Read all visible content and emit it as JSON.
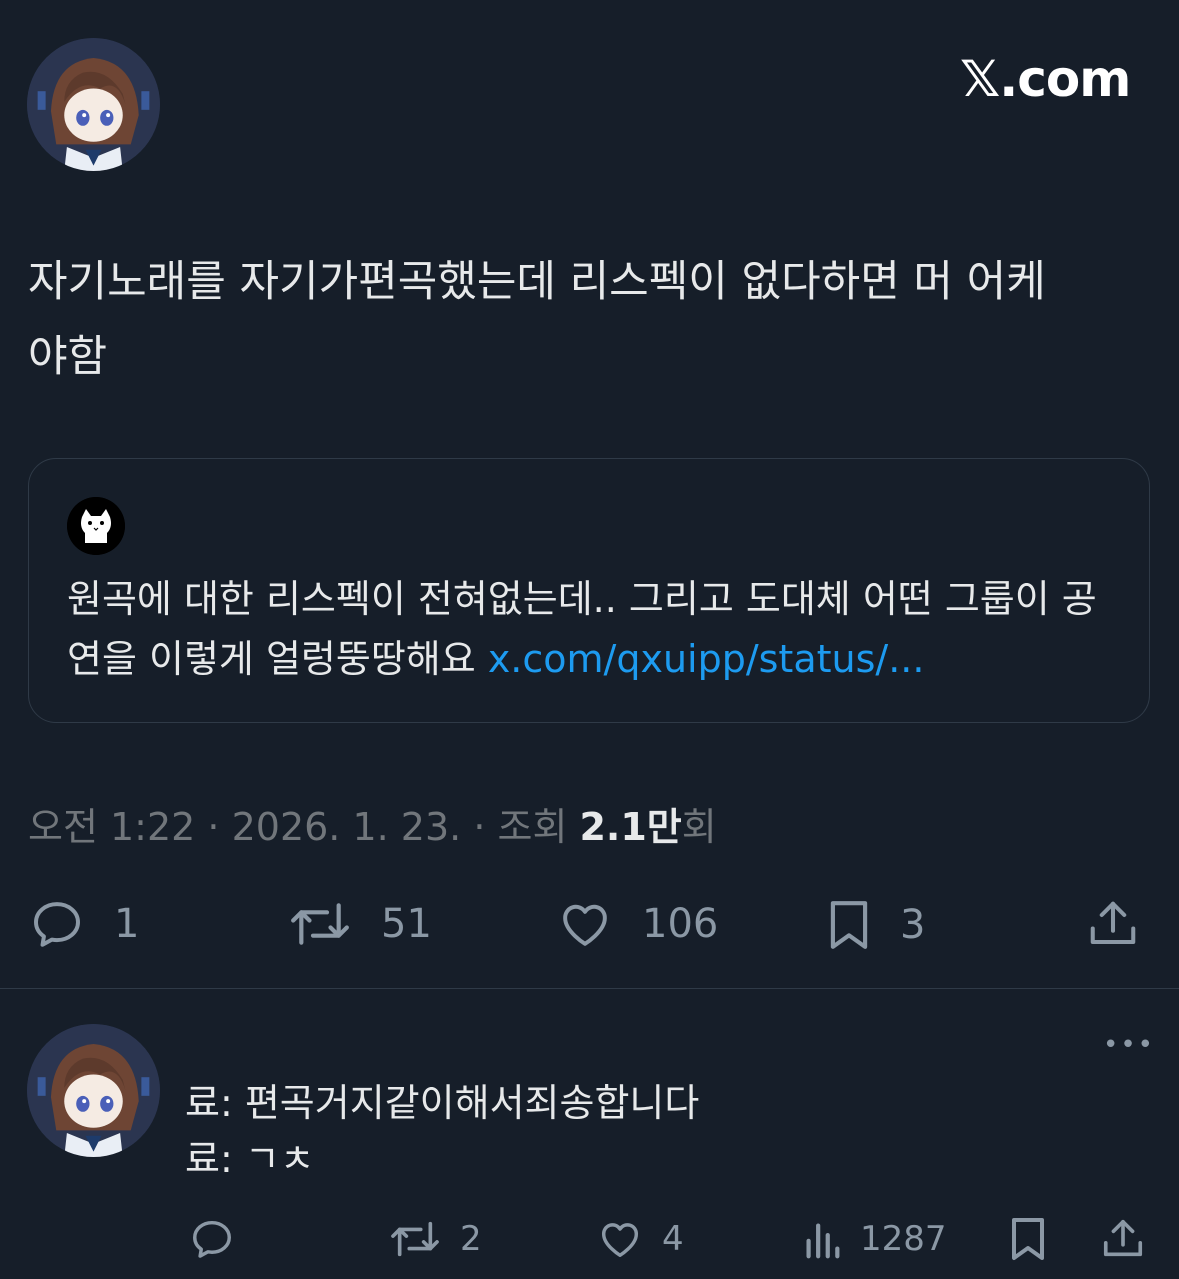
{
  "header": {
    "brand": "𝕏.com"
  },
  "tweet": {
    "text_line1": "자기노래를 자기가편곡했는데 리스펙이 없다하면 머 어케",
    "text_line2": "야함",
    "quote": {
      "text": "원곡에 대한 리스펙이 전혀없는데.. 그리고 도대체 어떤 그룹이 공연을 이렇게 얼렁뚱땅해요 ",
      "link": "x.com/qxuipp/status/..."
    },
    "meta": {
      "time": "오전 1:22",
      "sep1": " · ",
      "date": "2026. 1. 23.",
      "sep2": " · ",
      "views_label": "조회 ",
      "views_count": "2.1만",
      "views_suffix": "회"
    },
    "actions": {
      "replies": "1",
      "retweets": "51",
      "likes": "106",
      "bookmarks": "3"
    }
  },
  "reply": {
    "line1": "료: 편곡거지같이해서죄송합니다",
    "line2": "료: ㄱㅊ",
    "more": "•••",
    "actions": {
      "retweets": "2",
      "likes": "4",
      "views": "1287"
    }
  },
  "colors": {
    "background": "#161e29",
    "text": "#e7e9ea",
    "muted": "#71767b",
    "link": "#1d9bf0",
    "border": "#2f3a47"
  }
}
